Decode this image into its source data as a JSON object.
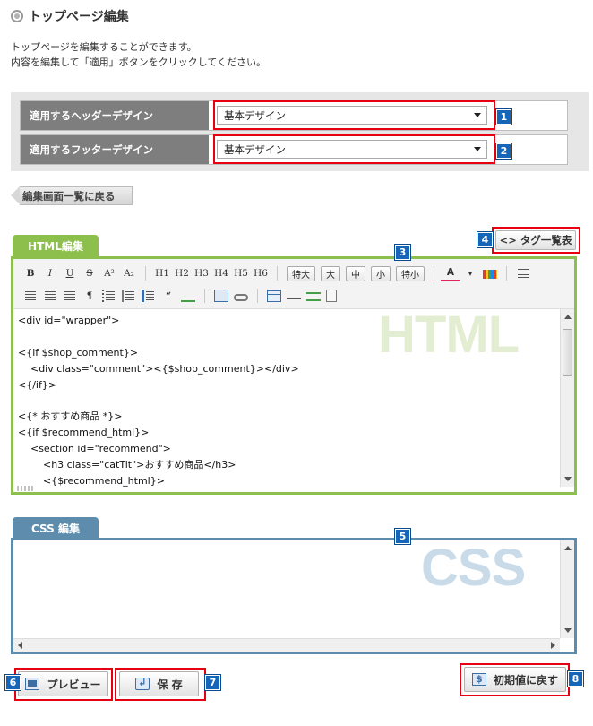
{
  "page": {
    "title": "トップページ編集",
    "description_line1": "トップページを編集することができます。",
    "description_line2": "内容を編集して「適用」ボタンをクリックしてください。"
  },
  "settings": {
    "header_design": {
      "label": "適用するヘッダーデザイン",
      "selected": "基本デザイン"
    },
    "footer_design": {
      "label": "適用するフッターデザイン",
      "selected": "基本デザイン"
    }
  },
  "back_button": {
    "label": "編集画面一覧に戻る"
  },
  "html_editor": {
    "tab_label": "HTML編集",
    "watermark": "HTML",
    "tag_list_button": {
      "icon_text": "<>",
      "label": "タグ一覧表"
    },
    "toolbar": {
      "format_buttons": [
        "B",
        "I",
        "U",
        "S",
        "A²",
        "A₂"
      ],
      "heading_buttons": [
        "H1",
        "H2",
        "H3",
        "H4",
        "H5",
        "H6"
      ],
      "size_buttons": [
        "特大",
        "大",
        "中",
        "小",
        "特小"
      ],
      "misc_symbols": [
        "¶",
        "“"
      ]
    },
    "code_lines": [
      "<div id=\"wrapper\">",
      "",
      "<{if $shop_comment}>",
      "    <div class=\"comment\"><{$shop_comment}></div>",
      "<{/if}>",
      "",
      "<{* おすすめ商品 *}>",
      "<{if $recommend_html}>",
      "    <section id=\"recommend\">",
      "        <h3 class=\"catTit\">おすすめ商品</h3>",
      "        <{$recommend_html}>"
    ]
  },
  "css_editor": {
    "tab_label": "CSS 編集",
    "watermark": "CSS",
    "content": ""
  },
  "buttons": {
    "preview": "プレビュー",
    "save": "保 存",
    "reset": "初期値に戻す"
  },
  "badges": [
    "1",
    "2",
    "3",
    "4",
    "5",
    "6",
    "7",
    "8"
  ],
  "colors": {
    "highlight_red": "#e60012",
    "badge_blue": "#1565b8",
    "html_green": "#8cbf4b",
    "css_blue": "#5d8cad"
  }
}
